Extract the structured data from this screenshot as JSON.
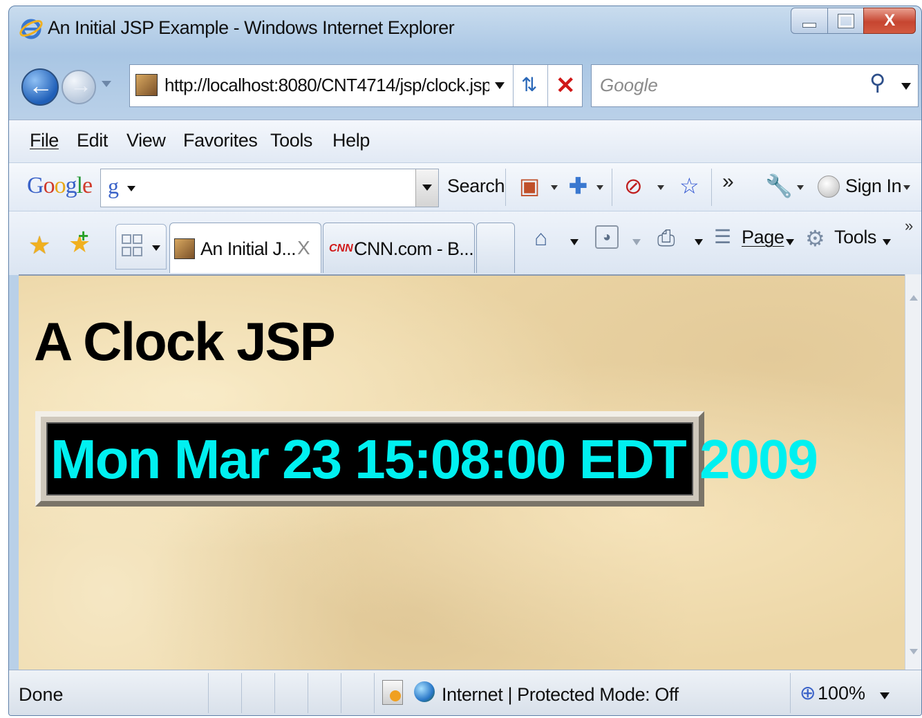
{
  "window": {
    "title": "An Initial JSP Example - Windows Internet Explorer",
    "controls": {
      "minimize": "minimize-icon",
      "maximize": "maximize-icon",
      "close": "X"
    }
  },
  "nav": {
    "address": "http://localhost:8080/CNT4714/jsp/clock.jsp",
    "search_placeholder": "Google"
  },
  "menu": {
    "items": [
      {
        "label": "File",
        "key": "F"
      },
      {
        "label": "Edit",
        "key": "E"
      },
      {
        "label": "View",
        "key": "V"
      },
      {
        "label": "Favorites",
        "key": "a"
      },
      {
        "label": "Tools",
        "key": "T"
      },
      {
        "label": "Help",
        "key": "H"
      }
    ]
  },
  "google_toolbar": {
    "logo": "Google",
    "search_label": "Search",
    "more": "»",
    "sign_in": "Sign In"
  },
  "tabs": {
    "items": [
      {
        "label": "An Initial J...",
        "close": "X",
        "active": true
      },
      {
        "label": "CNN.com - B...",
        "badge": "CNN",
        "active": false
      }
    ]
  },
  "command_bar": {
    "page_label": "Page",
    "tools_label": "Tools",
    "overflow": "»"
  },
  "page": {
    "heading": "A Clock JSP",
    "clock": "Mon Mar 23 15:08:00 EDT 2009",
    "clock_color": "#00f0f0",
    "clock_bg": "#000000"
  },
  "status": {
    "text": "Done",
    "zone": "Internet | Protected Mode: Off",
    "zoom": "100%"
  }
}
